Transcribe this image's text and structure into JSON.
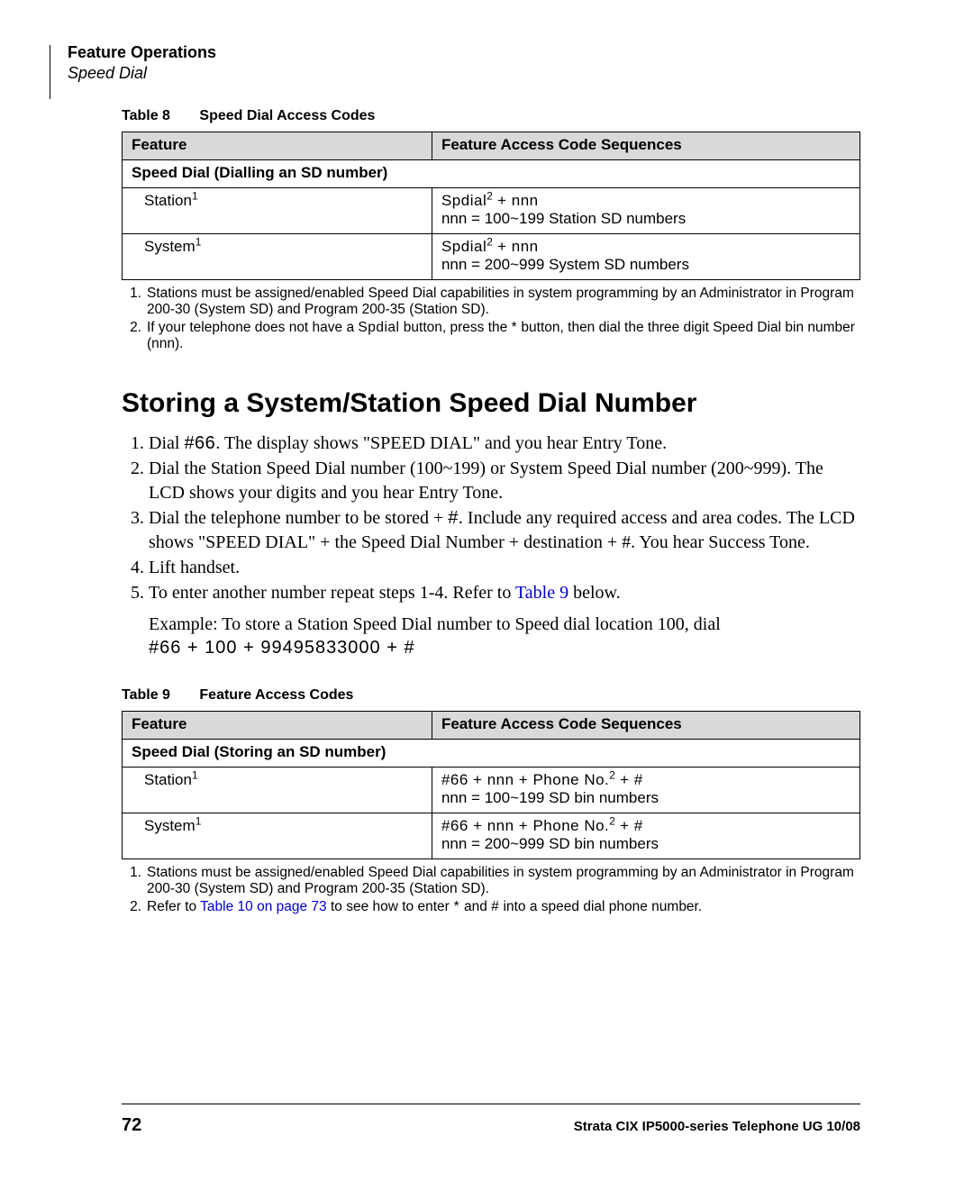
{
  "header": {
    "section": "Feature Operations",
    "subsection": "Speed Dial"
  },
  "table8": {
    "caption_num": "Table 8",
    "caption_title": "Speed Dial Access Codes",
    "col1": "Feature",
    "col2": "Feature Access Code Sequences",
    "subhead": "Speed Dial (Dialling an SD number)",
    "rows": [
      {
        "feature": "Station",
        "sup": "1",
        "seq_l1_pre": "Spdial",
        "seq_l1_sup": "2",
        "seq_l1_post": " + nnn",
        "seq_l2": "nnn = 100~199 Station SD numbers"
      },
      {
        "feature": "System",
        "sup": "1",
        "seq_l1_pre": "Spdial",
        "seq_l1_sup": "2",
        "seq_l1_post": " + nnn",
        "seq_l2": "nnn = 200~999 System SD numbers"
      }
    ]
  },
  "footnotes1": {
    "n1": "1.",
    "t1": "Stations must be assigned/enabled Speed Dial capabilities in system programming by an Administrator in Program 200-30 (System SD) and Program 200-35 (Station SD).",
    "n2": "2.",
    "t2a": "If your telephone does not have a ",
    "t2b": "Spdial",
    "t2c": " button, press the ",
    "t2d": "*",
    "t2e": " button, then dial the three digit Speed Dial bin number (nnn)."
  },
  "heading": "Storing a System/Station Speed Dial Number",
  "steps": {
    "s1a": "Dial ",
    "s1b": "#66",
    "s1c": ". The display shows \"SPEED DIAL\" and you hear Entry Tone.",
    "s2": "Dial the Station Speed Dial number (100~199) or System Speed Dial number (200~999). The LCD shows your digits and you hear Entry Tone.",
    "s3a": "Dial the telephone number to be stored + ",
    "s3b": "#",
    "s3c": ". Include any required access and area codes. The LCD shows \"SPEED DIAL\" + the Speed Dial Number + destination + #. You hear Success Tone.",
    "s4": "Lift handset.",
    "s5a": "To enter another number repeat steps 1-4. Refer to ",
    "s5b": "Table 9",
    "s5c": " below."
  },
  "example": {
    "l1": "Example: To store a Station Speed Dial number to Speed dial location 100, dial",
    "l2": "#66 + 100 + 99495833000 + #"
  },
  "table9": {
    "caption_num": "Table 9",
    "caption_title": "Feature Access Codes",
    "col1": "Feature",
    "col2": "Feature Access Code Sequences",
    "subhead": "Speed Dial (Storing an SD number)",
    "rows": [
      {
        "feature": "Station",
        "sup": "1",
        "seq_l1_pre": "#66 + nnn + Phone No.",
        "seq_l1_sup": "2",
        "seq_l1_post": " + #",
        "seq_l2": "nnn = 100~199 SD bin numbers"
      },
      {
        "feature": "System",
        "sup": "1",
        "seq_l1_pre": "#66 + nnn + Phone No.",
        "seq_l1_sup": "2",
        "seq_l1_post": " + #",
        "seq_l2": "nnn = 200~999 SD bin numbers"
      }
    ]
  },
  "footnotes2": {
    "n1": "1.",
    "t1": "Stations must be assigned/enabled Speed Dial capabilities in system programming by an Administrator in Program 200-30 (System SD) and Program 200-35 (Station SD).",
    "n2": "2.",
    "t2a": "Refer to ",
    "t2b": "Table 10 on page 73",
    "t2c": " to see how to enter",
    "t2d": " * ",
    "t2e": "and ",
    "t2f": "#",
    "t2g": " into a speed dial phone number."
  },
  "footer": {
    "page": "72",
    "doc": "Strata CIX IP5000-series Telephone UG    10/08"
  }
}
